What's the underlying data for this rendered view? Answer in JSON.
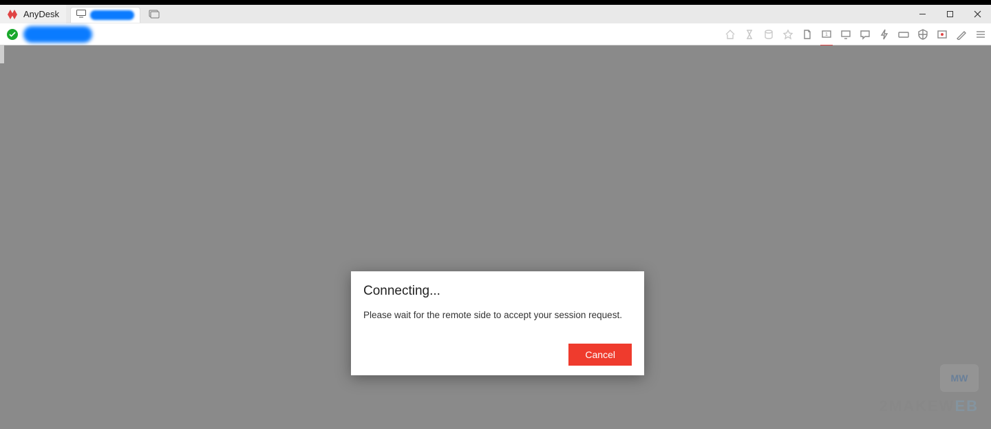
{
  "app": {
    "name": "AnyDesk"
  },
  "dialog": {
    "title": "Connecting...",
    "message": "Please wait for the remote side to accept your session request.",
    "cancel_label": "Cancel"
  },
  "watermark": {
    "badge": "MW",
    "text_prefix": "2MAKEW",
    "text_suffix": "EB"
  }
}
